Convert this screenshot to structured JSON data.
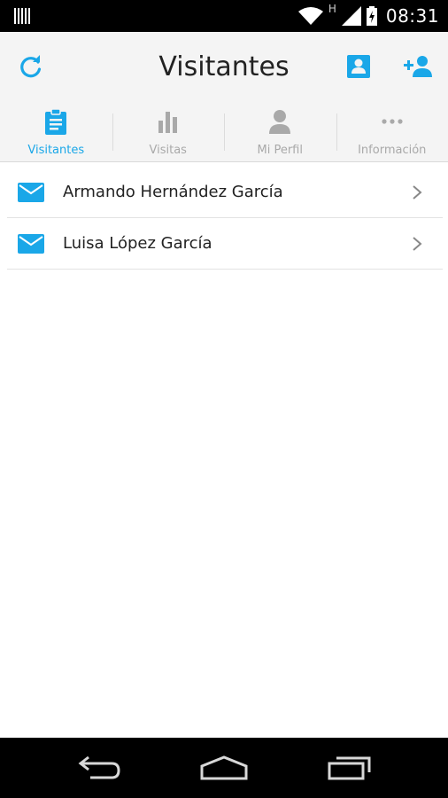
{
  "status_bar": {
    "time": "08:31",
    "network_label": "H",
    "icons": [
      "barcode-icon",
      "wifi-icon",
      "signal-icon",
      "battery-icon"
    ]
  },
  "app_bar": {
    "title": "Visitantes",
    "left_icon": "refresh-icon",
    "right_icons": [
      "contact-card-icon",
      "add-person-icon"
    ]
  },
  "tabs": [
    {
      "label": "Visitantes",
      "icon": "clipboard-icon",
      "active": true
    },
    {
      "label": "Visitas",
      "icon": "bar-chart-icon",
      "active": false
    },
    {
      "label": "Mi Perfil",
      "icon": "person-icon",
      "active": false
    },
    {
      "label": "Información",
      "icon": "more-dots-icon",
      "active": false
    }
  ],
  "visitors": [
    {
      "name": "Armando Hernández García",
      "icon": "mail-icon"
    },
    {
      "name": "Luisa López García",
      "icon": "mail-icon"
    }
  ],
  "colors": {
    "accent": "#1aa7e8",
    "inactive": "#a9a9a9",
    "bar_background": "#f4f4f4"
  },
  "nav_bar": {
    "icons": [
      "back-icon",
      "home-icon",
      "recents-icon"
    ]
  }
}
